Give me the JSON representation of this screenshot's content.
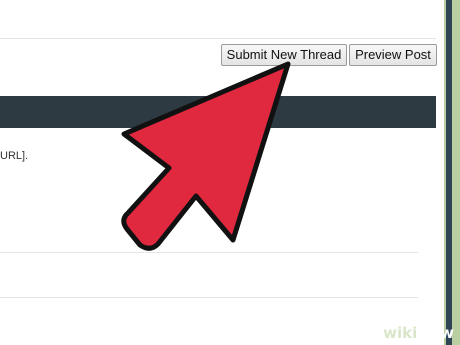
{
  "toolbar": {
    "submit_label": "Submit New Thread",
    "preview_label": "Preview Post"
  },
  "content": {
    "snippet_text": "URL]."
  },
  "overlay": {
    "icon": "pointer-arrow-icon",
    "arrow_color": "#e0283f"
  },
  "watermark": {
    "part1": "wiki",
    "part2": "How"
  },
  "colors": {
    "background_green": "#b9cfa1",
    "header_bar": "#2e3a42",
    "side_strip": "#2f4455"
  }
}
